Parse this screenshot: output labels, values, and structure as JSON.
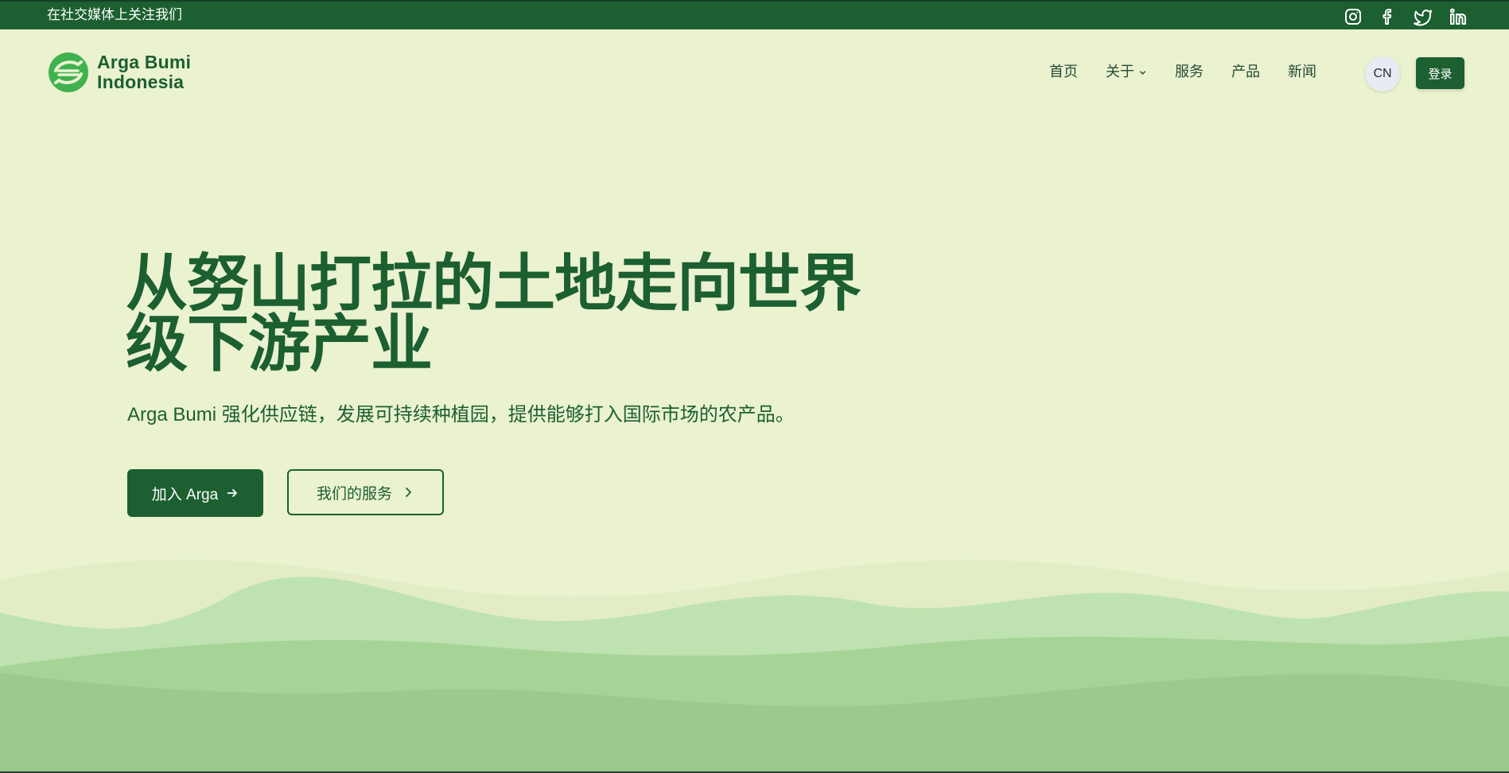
{
  "topbar": {
    "follow_text": "在社交媒体上关注我们",
    "social": [
      "instagram-icon",
      "facebook-icon",
      "twitter-icon",
      "linkedin-icon"
    ]
  },
  "header": {
    "logo_line1": "Arga Bumi",
    "logo_line2": "Indonesia",
    "nav": [
      {
        "label": "首页"
      },
      {
        "label": "关于",
        "has_dropdown": true
      },
      {
        "label": "服务"
      },
      {
        "label": "产品"
      },
      {
        "label": "新闻"
      }
    ],
    "lang": "CN",
    "login": "登录"
  },
  "hero": {
    "title": "从努山打拉的土地走向世界级下游产业",
    "subtitle": "Arga Bumi 强化供应链，发展可持续种植园，提供能够打入国际市场的农产品。",
    "primary_button": "加入 Arga",
    "secondary_button": "我们的服务"
  },
  "colors": {
    "brand_green": "#1c5f30",
    "background": "#eaf2d0",
    "wave_light": "#bfe3b0",
    "wave_mid": "#a6d497",
    "wave_dark": "#9acb8c"
  }
}
